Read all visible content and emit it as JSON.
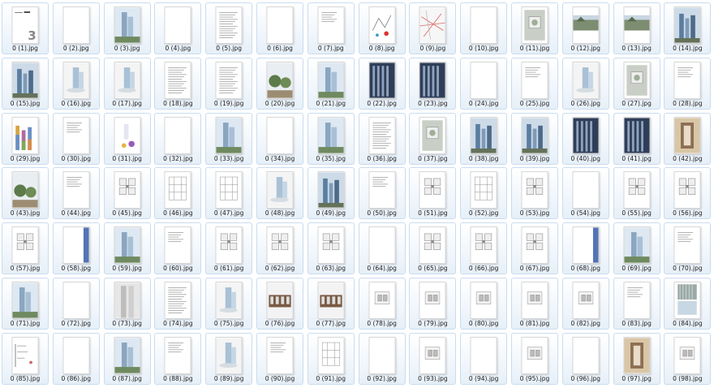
{
  "folder": {
    "files": [
      {
        "name": "0 (1).jpg",
        "kind": "cover"
      },
      {
        "name": "0 (2).jpg",
        "kind": "blank"
      },
      {
        "name": "0 (3).jpg",
        "kind": "tower"
      },
      {
        "name": "0 (4).jpg",
        "kind": "blank"
      },
      {
        "name": "0 (5).jpg",
        "kind": "text"
      },
      {
        "name": "0 (6).jpg",
        "kind": "blank"
      },
      {
        "name": "0 (7).jpg",
        "kind": "text-small"
      },
      {
        "name": "0 (8).jpg",
        "kind": "sketch"
      },
      {
        "name": "0 (9).jpg",
        "kind": "map"
      },
      {
        "name": "0 (10).jpg",
        "kind": "blank"
      },
      {
        "name": "0 (11).jpg",
        "kind": "plan-photo"
      },
      {
        "name": "0 (12).jpg",
        "kind": "photo-landscape"
      },
      {
        "name": "0 (13).jpg",
        "kind": "photo-landscape"
      },
      {
        "name": "0 (14).jpg",
        "kind": "photo-city"
      },
      {
        "name": "0 (15).jpg",
        "kind": "photo-city"
      },
      {
        "name": "0 (16).jpg",
        "kind": "render-small"
      },
      {
        "name": "0 (17).jpg",
        "kind": "render-small"
      },
      {
        "name": "0 (18).jpg",
        "kind": "text"
      },
      {
        "name": "0 (19).jpg",
        "kind": "text"
      },
      {
        "name": "0 (20).jpg",
        "kind": "photo-tree"
      },
      {
        "name": "0 (21).jpg",
        "kind": "tower"
      },
      {
        "name": "0 (22).jpg",
        "kind": "photo-dark"
      },
      {
        "name": "0 (23).jpg",
        "kind": "photo-dark"
      },
      {
        "name": "0 (24).jpg",
        "kind": "blank"
      },
      {
        "name": "0 (25).jpg",
        "kind": "text-small"
      },
      {
        "name": "0 (26).jpg",
        "kind": "render-small"
      },
      {
        "name": "0 (27).jpg",
        "kind": "plan-photo"
      },
      {
        "name": "0 (28).jpg",
        "kind": "text-small"
      },
      {
        "name": "0 (29).jpg",
        "kind": "chart"
      },
      {
        "name": "0 (30).jpg",
        "kind": "text-small"
      },
      {
        "name": "0 (31).jpg",
        "kind": "chart-small"
      },
      {
        "name": "0 (32).jpg",
        "kind": "blank"
      },
      {
        "name": "0 (33).jpg",
        "kind": "tower"
      },
      {
        "name": "0 (34).jpg",
        "kind": "blank"
      },
      {
        "name": "0 (35).jpg",
        "kind": "tower"
      },
      {
        "name": "0 (36).jpg",
        "kind": "text"
      },
      {
        "name": "0 (37).jpg",
        "kind": "plan-photo"
      },
      {
        "name": "0 (38).jpg",
        "kind": "photo-city"
      },
      {
        "name": "0 (39).jpg",
        "kind": "photo-city"
      },
      {
        "name": "0 (40).jpg",
        "kind": "photo-dark"
      },
      {
        "name": "0 (41).jpg",
        "kind": "photo-dark"
      },
      {
        "name": "0 (42).jpg",
        "kind": "photo-warm"
      },
      {
        "name": "0 (43).jpg",
        "kind": "photo-tree"
      },
      {
        "name": "0 (44).jpg",
        "kind": "text-small"
      },
      {
        "name": "0 (45).jpg",
        "kind": "plan"
      },
      {
        "name": "0 (46).jpg",
        "kind": "plan-grid"
      },
      {
        "name": "0 (47).jpg",
        "kind": "plan-grid"
      },
      {
        "name": "0 (48).jpg",
        "kind": "render-small"
      },
      {
        "name": "0 (49).jpg",
        "kind": "photo-city"
      },
      {
        "name": "0 (50).jpg",
        "kind": "text-small"
      },
      {
        "name": "0 (51).jpg",
        "kind": "plan"
      },
      {
        "name": "0 (52).jpg",
        "kind": "plan-grid"
      },
      {
        "name": "0 (53).jpg",
        "kind": "plan"
      },
      {
        "name": "0 (54).jpg",
        "kind": "blank"
      },
      {
        "name": "0 (55).jpg",
        "kind": "plan"
      },
      {
        "name": "0 (56).jpg",
        "kind": "plan"
      },
      {
        "name": "0 (57).jpg",
        "kind": "plan"
      },
      {
        "name": "0 (58).jpg",
        "kind": "sliver"
      },
      {
        "name": "0 (59).jpg",
        "kind": "tower"
      },
      {
        "name": "0 (60).jpg",
        "kind": "text-small"
      },
      {
        "name": "0 (61).jpg",
        "kind": "plan"
      },
      {
        "name": "0 (62).jpg",
        "kind": "plan"
      },
      {
        "name": "0 (63).jpg",
        "kind": "plan"
      },
      {
        "name": "0 (64).jpg",
        "kind": "blank"
      },
      {
        "name": "0 (65).jpg",
        "kind": "plan"
      },
      {
        "name": "0 (66).jpg",
        "kind": "plan"
      },
      {
        "name": "0 (67).jpg",
        "kind": "plan"
      },
      {
        "name": "0 (68).jpg",
        "kind": "sliver"
      },
      {
        "name": "0 (69).jpg",
        "kind": "tower"
      },
      {
        "name": "0 (70).jpg",
        "kind": "text-small"
      },
      {
        "name": "0 (71).jpg",
        "kind": "tower"
      },
      {
        "name": "0 (72).jpg",
        "kind": "blank"
      },
      {
        "name": "0 (73).jpg",
        "kind": "tower-pair"
      },
      {
        "name": "0 (74).jpg",
        "kind": "text"
      },
      {
        "name": "0 (75).jpg",
        "kind": "render-small"
      },
      {
        "name": "0 (76).jpg",
        "kind": "facade"
      },
      {
        "name": "0 (77).jpg",
        "kind": "facade"
      },
      {
        "name": "0 (78).jpg",
        "kind": "section"
      },
      {
        "name": "0 (79).jpg",
        "kind": "section"
      },
      {
        "name": "0 (80).jpg",
        "kind": "section"
      },
      {
        "name": "0 (81).jpg",
        "kind": "section"
      },
      {
        "name": "0 (82).jpg",
        "kind": "section"
      },
      {
        "name": "0 (83).jpg",
        "kind": "text-small"
      },
      {
        "name": "0 (84).jpg",
        "kind": "photo-bars"
      },
      {
        "name": "0 (85).jpg",
        "kind": "diagram"
      },
      {
        "name": "0 (86).jpg",
        "kind": "blank"
      },
      {
        "name": "0 (87).jpg",
        "kind": "tower"
      },
      {
        "name": "0 (88).jpg",
        "kind": "text-small"
      },
      {
        "name": "0 (89).jpg",
        "kind": "render-small"
      },
      {
        "name": "0 (90).jpg",
        "kind": "text-small"
      },
      {
        "name": "0 (91).jpg",
        "kind": "plan-grid"
      },
      {
        "name": "0 (92).jpg",
        "kind": "blank"
      },
      {
        "name": "0 (93).jpg",
        "kind": "section"
      },
      {
        "name": "0 (94).jpg",
        "kind": "blank"
      },
      {
        "name": "0 (95).jpg",
        "kind": "section"
      },
      {
        "name": "0 (96).jpg",
        "kind": "blank"
      },
      {
        "name": "0 (97).jpg",
        "kind": "photo-warm"
      },
      {
        "name": "0 (98).jpg",
        "kind": "section"
      }
    ]
  }
}
